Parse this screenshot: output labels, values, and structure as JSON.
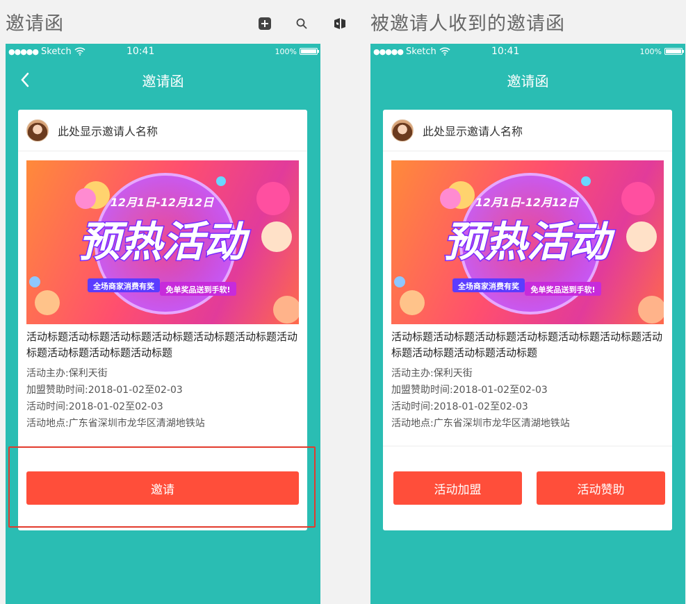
{
  "boards": {
    "left_title": "邀请函",
    "right_title": "被邀请人收到的邀请函"
  },
  "status_bar": {
    "carrier": "Sketch",
    "time": "10:41",
    "battery": "100%"
  },
  "nav": {
    "title": "邀请函"
  },
  "card": {
    "inviter_name": "此处显示邀请人名称",
    "banner": {
      "date_range": "12月1日-12月12日",
      "headline": "预热活动",
      "tag_left": "全场商家消费有奖",
      "tag_right": "免单奖品送到手软!"
    },
    "event_title": "活动标题活动标题活动标题活动标题活动标题活动标题活动标题活动标题活动标题活动标题",
    "organizer": "活动主办:保利天街",
    "join_sponsor_time": "加盟赞助时间:2018-01-02至02-03",
    "event_time": "活动时间:2018-01-02至02-03",
    "location": "活动地点:广东省深圳市龙华区清湖地铁站"
  },
  "buttons": {
    "invite": "邀请",
    "join": "活动加盟",
    "sponsor": "活动赞助"
  },
  "colors": {
    "teal": "#2abdb3",
    "accent": "#ff4e3a",
    "highlight": "#e23a2c"
  }
}
